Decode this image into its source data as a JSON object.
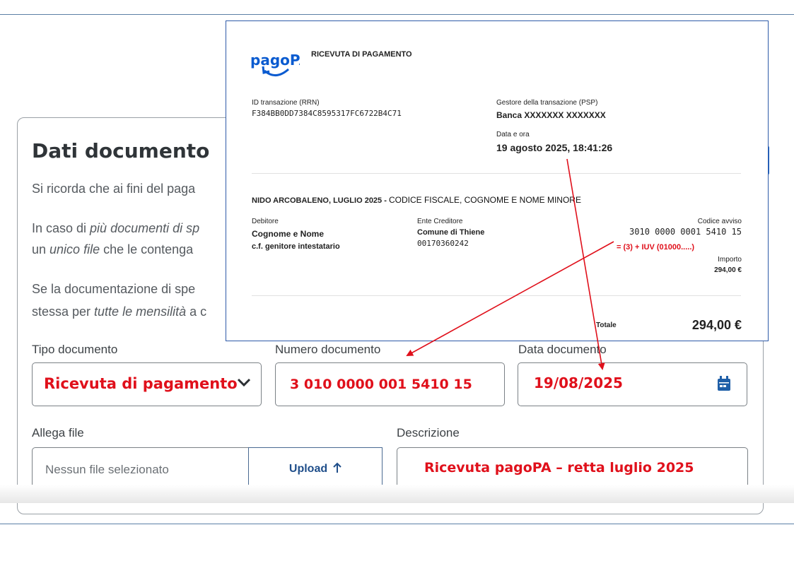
{
  "form": {
    "title": "Dati documento",
    "para1": "Si ricorda che ai fini del paga",
    "para2_a": "In caso di ",
    "para2_b": "più documenti di sp",
    "para2_c_pre": "un ",
    "para2_c_em": "unico file",
    "para2_c_post": " che le contenga",
    "para3_a": "Se la documentazione di spe",
    "para3_b_pre": "stessa per ",
    "para3_b_em": "tutte le mensilità",
    "para3_b_post": " a c",
    "tipo_label": "Tipo documento",
    "tipo_value": "Ricevuta di pagamento",
    "numero_label": "Numero documento",
    "numero_value": "3 010 0000 001 5410 15",
    "data_label": "Data documento",
    "data_value": "19/08/2025",
    "allega_label": "Allega file",
    "file_placeholder": "Nessun file selezionato",
    "upload_label": "Upload",
    "descr_label": "Descrizione",
    "descr_value": "Ricevuta pagoPA – retta luglio 2025"
  },
  "receipt": {
    "logo_text": "pagoPA",
    "heading": "RICEVUTA DI PAGAMENTO",
    "id_label": "ID transazione (RRN)",
    "id_value": "F384BB0DD7384C8595317FC6722B4C71",
    "psp_label": "Gestore della transazione (PSP)",
    "psp_value": "Banca XXXXXXX XXXXXXX",
    "datetime_label": "Data e ora",
    "datetime_value": "19 agosto 2025, 18:41:26",
    "subject_a": "NIDO ARCOBALENO, LUGLIO 2025 - ",
    "subject_b": "CODICE FISCALE, COGNOME E NOME MINORE",
    "debitore_label": "Debitore",
    "debitore_name": "Cognome  e Nome",
    "debitore_cf": "c.f. genitore intestatario",
    "ente_label": "Ente Creditore",
    "ente_name": "Comune di Thiene",
    "ente_cf": "00170360242",
    "avviso_label": "Codice avviso",
    "avviso_value": "3010 0000 0001 5410 15",
    "iuv_note": "= (3) + IUV (01000.....)",
    "importo_label": "Importo",
    "importo_value": "294,00 €",
    "totale_label": "Totale",
    "totale_value": "294,00 €"
  },
  "colors": {
    "accent_red": "#e0101b",
    "brand_blue": "#0a5bd0",
    "frame_blue": "#2e5aa8"
  },
  "icons": {
    "select_chevron": "chevron-down-icon",
    "calendar": "calendar-icon",
    "upload": "arrow-up-icon"
  }
}
